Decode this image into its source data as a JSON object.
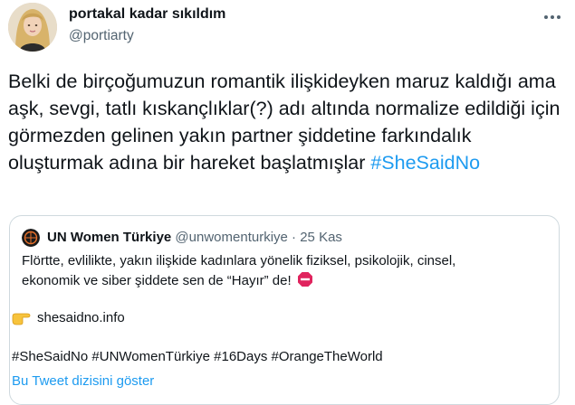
{
  "author": {
    "display_name": "portakal kadar sıkıldım",
    "handle": "@portiarty"
  },
  "icons": {
    "avatar": "profile-photo",
    "more": "more-horizontal-icon"
  },
  "tweet": {
    "text": "Belki de birçoğumuzun romantik ilişkideyken maruz kaldığı ama aşk, sevgi, tatlı kıskançlıklar(?) adı altında normalize edildiği için görmezden gelinen yakın partner şiddetine farkındalık oluşturmak adına bir hareket başlatmışlar",
    "hashtag": "#SheSaidNo"
  },
  "quoted": {
    "name": "UN Women Türkiye",
    "handle": "@unwomenturkiye",
    "separator": "·",
    "date": "25 Kas",
    "line1": "Flörtte, evlilikte, yakın ilişkide kadınlara yönelik fiziksel, psikolojik, cinsel,",
    "line2": "ekonomik ve siber şiddete sen de “Hayır” de!",
    "link": "shesaidno.info",
    "hashtags": "#SheSaidNo #UNWomenTürkiye #16Days #OrangeTheWorld",
    "show_thread": "Bu Tweet dizisini göster"
  },
  "colors": {
    "link_blue": "#1d9bf0",
    "secondary": "#536471",
    "border": "#cfd9de",
    "stop_red": "#e0245e"
  }
}
